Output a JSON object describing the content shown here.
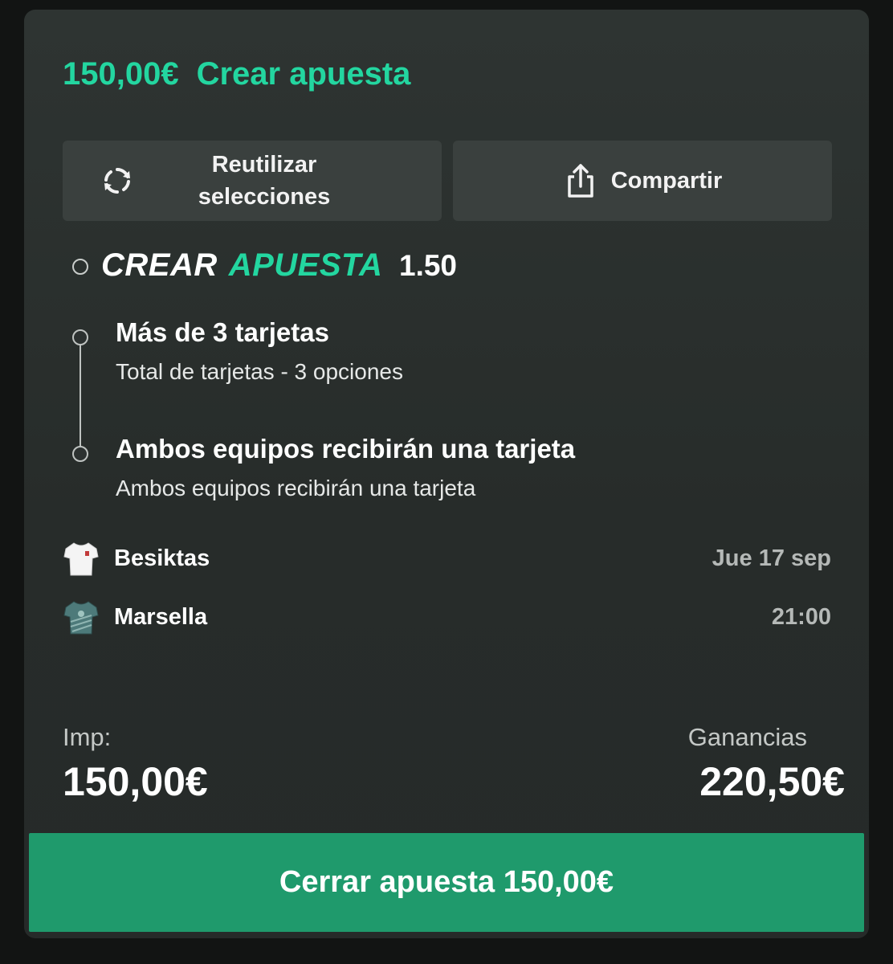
{
  "colors": {
    "accent": "#23d6a0",
    "card_bg": "#2e3432",
    "button_bg": "#3a403e",
    "cta_bg": "#1f9a6c"
  },
  "header": {
    "amount": "150,00€",
    "title": "Crear apuesta"
  },
  "actions": {
    "reuse": {
      "icon": "refresh-icon",
      "label_line1": "Reutilizar",
      "label_line2": "selecciones"
    },
    "share": {
      "icon": "share-icon",
      "label": "Compartir"
    }
  },
  "bet_builder": {
    "logo_part1": "CREAR",
    "logo_part2": "APUESTA",
    "odds": "1.50",
    "selections": [
      {
        "title": "Más de 3 tarjetas",
        "subtitle": "Total de tarjetas - 3 opciones"
      },
      {
        "title": "Ambos equipos recibirán una tarjeta",
        "subtitle": "Ambos equipos recibirán una tarjeta"
      }
    ]
  },
  "match": {
    "home": {
      "name": "Besiktas",
      "icon": "white-shirt-icon"
    },
    "away": {
      "name": "Marsella",
      "icon": "teal-shirt-icon"
    },
    "date": "Jue 17 sep",
    "time": "21:00"
  },
  "summary": {
    "stake_label": "Imp:",
    "stake_value": "150,00€",
    "win_label": "Ganancias",
    "win_value": "220,50€"
  },
  "cta": {
    "label": "Cerrar apuesta 150,00€"
  }
}
